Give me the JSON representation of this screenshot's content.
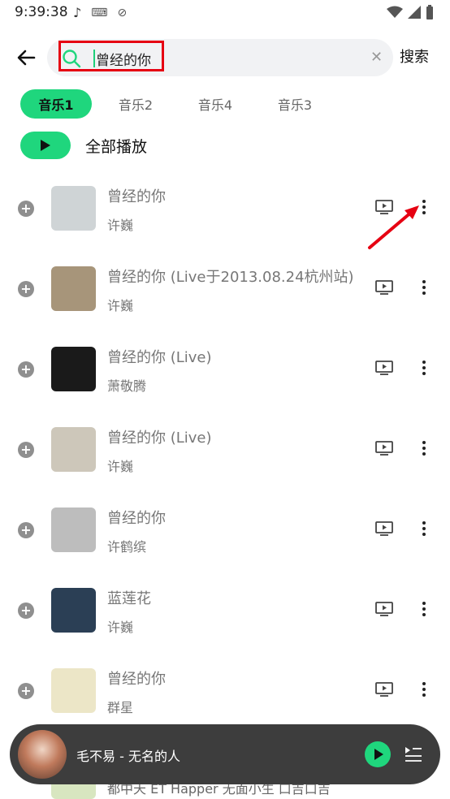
{
  "status_bar": {
    "time": "9:39:38"
  },
  "search": {
    "query": "曾经的你",
    "button_label": "搜索"
  },
  "tabs": [
    {
      "label": "音乐1",
      "active": true
    },
    {
      "label": "音乐2",
      "active": false
    },
    {
      "label": "音乐4",
      "active": false
    },
    {
      "label": "音乐3",
      "active": false
    }
  ],
  "play_all": {
    "label": "全部播放"
  },
  "songs": [
    {
      "title": "曾经的你",
      "artist": "许巍",
      "cover_color": "#cfd4d6"
    },
    {
      "title": "曾经的你 (Live于2013.08.24杭州站)",
      "artist": "许巍",
      "cover_color": "#a7957a"
    },
    {
      "title": "曾经的你 (Live)",
      "artist": "萧敬腾",
      "cover_color": "#1a1a1a"
    },
    {
      "title": "曾经的你 (Live)",
      "artist": "许巍",
      "cover_color": "#cdc7ba"
    },
    {
      "title": "曾经的你",
      "artist": "许鹤缤",
      "cover_color": "#bdbdbd"
    },
    {
      "title": "蓝莲花",
      "artist": "许巍",
      "cover_color": "#2b3f55"
    },
    {
      "title": "曾经的你",
      "artist": "群星",
      "cover_color": "#ece6c7"
    }
  ],
  "mini_player": {
    "title": "毛不易 - 无名的人"
  },
  "partial_row": {
    "text": "都中天 ET Happer 无面小生 口吉口吉"
  },
  "colors": {
    "accent": "#1fd67d",
    "highlight": "#e60012"
  }
}
